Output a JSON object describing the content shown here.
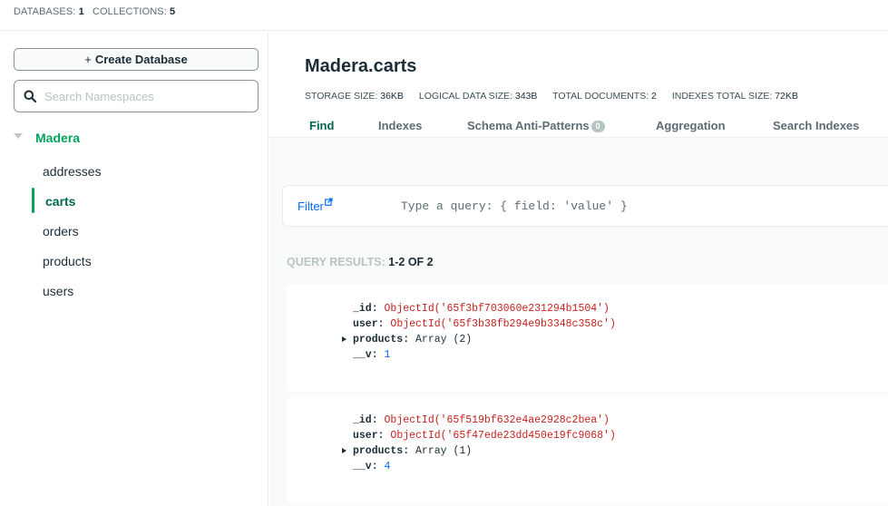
{
  "topbar": {
    "databases_label": "DATABASES:",
    "databases_count": "1",
    "collections_label": "COLLECTIONS:",
    "collections_count": "5"
  },
  "sidebar": {
    "create_button": "Create Database",
    "create_icon": "+",
    "search_placeholder": "Search Namespaces",
    "database": "Madera",
    "collections": [
      "addresses",
      "carts",
      "orders",
      "products",
      "users"
    ],
    "active_collection": "carts"
  },
  "main": {
    "title": "Madera.carts",
    "stats": {
      "storage_label": "STORAGE SIZE:",
      "storage_value": "36KB",
      "logical_label": "LOGICAL DATA SIZE:",
      "logical_value": "343B",
      "docs_label": "TOTAL DOCUMENTS:",
      "docs_value": "2",
      "indexes_label": "INDEXES TOTAL SIZE:",
      "indexes_value": "72KB"
    },
    "tabs": [
      {
        "label": "Find"
      },
      {
        "label": "Indexes"
      },
      {
        "label": "Schema Anti-Patterns",
        "badge": "0"
      },
      {
        "label": "Aggregation"
      },
      {
        "label": "Search Indexes"
      }
    ],
    "filter": {
      "label": "Filter",
      "placeholder": "Type a query: { field: 'value' }"
    },
    "results": {
      "label": "QUERY RESULTS:",
      "range": "1-2 OF 2"
    },
    "documents": [
      {
        "id_key": "_id:",
        "id_val": "ObjectId('65f3bf703060e231294b1504')",
        "user_key": "user:",
        "user_val": "ObjectId('65f3b38fb294e9b3348c358c')",
        "products_key": "products:",
        "products_val": "Array (2)",
        "v_key": "__v:",
        "v_val": "1"
      },
      {
        "id_key": "_id:",
        "id_val": "ObjectId('65f519bf632e4ae2928c2bea')",
        "user_key": "user:",
        "user_val": "ObjectId('65f47ede23dd450e19fc9068')",
        "products_key": "products:",
        "products_val": "Array (1)",
        "v_key": "__v:",
        "v_val": "4"
      }
    ]
  },
  "colors": {
    "accent_green": "#00a35c",
    "active_green": "#00684a",
    "link_blue": "#016bf8",
    "objectid_red": "#c5221f"
  },
  "icons": {
    "search": "search-icon",
    "caret": "caret-down-icon",
    "external": "external-link-icon",
    "expand": "expand-triangle-icon"
  }
}
